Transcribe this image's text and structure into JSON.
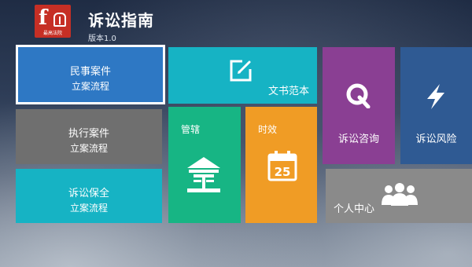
{
  "app": {
    "title": "诉讼指南",
    "version": "版本1.0",
    "logo_text": "最高法院"
  },
  "tiles": {
    "civil": {
      "line1": "民事案件",
      "line2": "立案流程"
    },
    "execution": {
      "line1": "执行案件",
      "line2": "立案流程"
    },
    "preservation": {
      "line1": "诉讼保全",
      "line2": "立案流程"
    },
    "document": {
      "label": "文书范本",
      "icon": "edit-icon"
    },
    "jurisdiction": {
      "label": "管辖",
      "icon": "court-icon"
    },
    "limitation": {
      "label": "时效",
      "icon": "calendar-icon",
      "calendar_day": "25"
    },
    "consult": {
      "label": "诉讼咨询",
      "icon": "q-icon"
    },
    "risk": {
      "label": "诉讼风险",
      "icon": "lightning-icon"
    },
    "personal": {
      "label": "个人中心",
      "icon": "users-icon"
    }
  },
  "colors": {
    "civil": "#2e78c4",
    "execution": "#6f6f6f",
    "preservation": "#16b3c4",
    "document": "#16b3c4",
    "jurisdiction": "#17b584",
    "limitation": "#f09c25",
    "consult": "#8a3f93",
    "risk": "#2f5a93",
    "personal": "#8a8a8a",
    "logo": "#c62f25"
  }
}
